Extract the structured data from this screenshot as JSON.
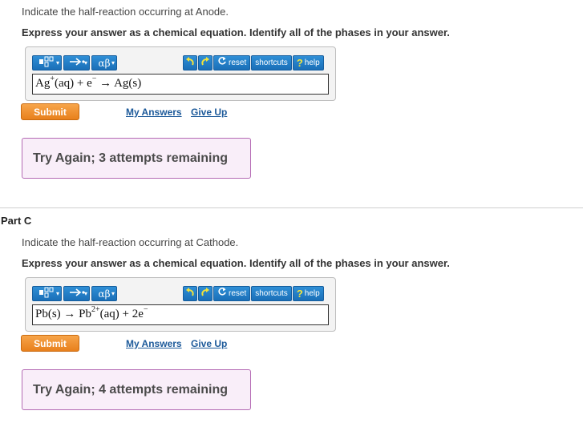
{
  "part_b": {
    "instruction": "Indicate the half-reaction occurring at Anode.",
    "express": "Express your answer as a chemical equation. Identify all of the phases in your answer.",
    "answer": {
      "p1": "Ag",
      "sup1": "+",
      "p2": "(aq) + e",
      "sup2": "−",
      "p3": " → Ag(s)"
    },
    "submit": "Submit",
    "my_answers": "My Answers",
    "give_up": "Give Up",
    "feedback": "Try Again; 3 attempts remaining"
  },
  "part_c": {
    "title": "Part C",
    "instruction": "Indicate the half-reaction occurring at Cathode.",
    "express": "Express your answer as a chemical equation. Identify all of the phases in your answer.",
    "answer": {
      "p1": "Pb(s) → Pb",
      "sup1": "2+",
      "p2": "(aq) + 2e",
      "sup2": "−"
    },
    "submit": "Submit",
    "my_answers": "My Answers",
    "give_up": "Give Up",
    "feedback": "Try Again; 4 attempts remaining"
  },
  "toolbar": {
    "greek_label": "αβ",
    "reset": "reset",
    "shortcuts": "shortcuts",
    "help": "help",
    "help_mark": "?",
    "icons": [
      "templates-icon",
      "arrow-icon",
      "greek-letters-icon",
      "undo-icon",
      "redo-icon",
      "reset-icon",
      "help-icon"
    ]
  }
}
